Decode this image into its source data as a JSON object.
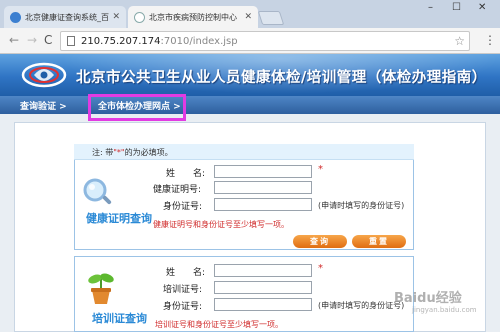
{
  "browser": {
    "tabs": [
      {
        "label": "北京健康证查询系统_百度",
        "active": false
      },
      {
        "label": "北京市疾病预防控制中心",
        "active": true
      }
    ],
    "window_controls": {
      "minimize": "–",
      "maximize": "☐",
      "close": "✕"
    },
    "nav": {
      "back": "←",
      "forward": "→",
      "reload": "C"
    },
    "address": {
      "host": "210.75.207.174",
      "path": ":7010/index.jsp"
    },
    "menu_icon": "⋮"
  },
  "header": {
    "title": "北京市公共卫生从业人员健康体检/培训管理（体检办理指南）"
  },
  "navbar": {
    "items": [
      {
        "label": "查询验证 >"
      },
      {
        "label": "全市体检办理网点 >",
        "highlighted": true
      }
    ],
    "highlight_color": "#e23be2"
  },
  "note": {
    "prefix": "注: 带",
    "mark": "\"*\"",
    "suffix": "的为必填项。"
  },
  "health_query": {
    "side_title": "健康证明查询",
    "fields": [
      {
        "label": "姓　　名:",
        "required": true
      },
      {
        "label": "健康证明号:",
        "required": false
      },
      {
        "label": "身份证号:",
        "required": false,
        "hint": "(申请时填写的身份证号)"
      }
    ],
    "warning": "健康证明号和身份证号至少填写一项。",
    "buttons": {
      "query": "查询",
      "reset": "重置"
    }
  },
  "training_query": {
    "side_title": "培训证查询",
    "fields": [
      {
        "label": "姓　　名:",
        "required": true
      },
      {
        "label": "培训证号:",
        "required": false
      },
      {
        "label": "身份证号:",
        "required": false,
        "hint": "(申请时填写的身份证号)"
      }
    ],
    "warning": "培训证号和身份证号至少填写一项。"
  },
  "required_mark": "*",
  "watermark": {
    "main": "Baidu经验",
    "sub": "jingyan.baidu.com"
  },
  "colors": {
    "banner": "#2f74c4",
    "navbar": "#2d5f9e",
    "button": "#e06d12",
    "warning": "#d02b2b",
    "side_title": "#2b8ad6"
  }
}
